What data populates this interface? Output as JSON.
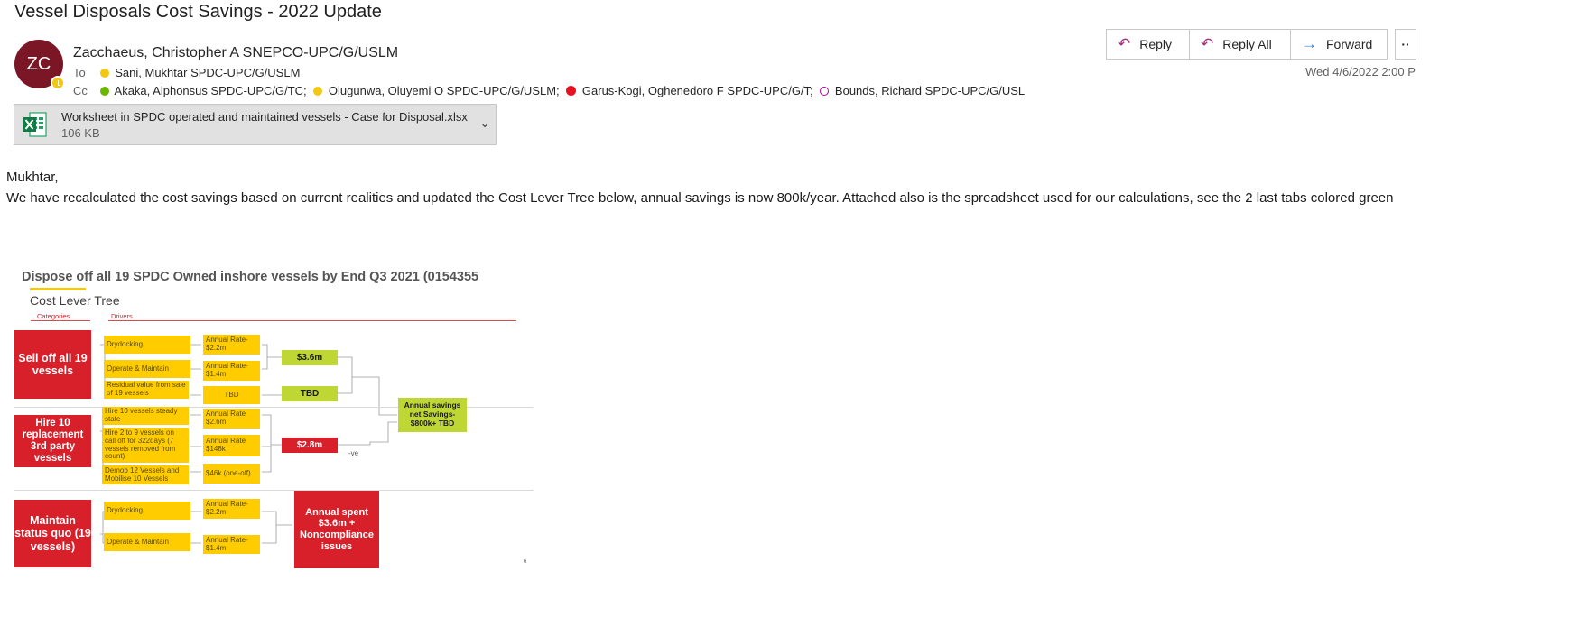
{
  "email": {
    "subject": "Vessel Disposals Cost Savings - 2022 Update",
    "avatar_initials": "ZC",
    "sender": "Zacchaeus, Christopher A SNEPCO-UPC/G/USLM",
    "to_label": "To",
    "to": "Sani, Mukhtar SPDC-UPC/G/USLM",
    "cc_label": "Cc",
    "cc": [
      {
        "name": "Akaka, Alphonsus SPDC-UPC/G/TC;",
        "status": "available"
      },
      {
        "name": "Olugunwa, Oluyemi O SPDC-UPC/G/USLM;",
        "status": "away"
      },
      {
        "name": "Garus-Kogi, Oghenedoro F SPDC-UPC/G/T;",
        "status": "busy"
      },
      {
        "name": "Bounds, Richard SPDC-UPC/G/USL",
        "status": "out-of-office"
      }
    ],
    "date": "Wed 4/6/2022 2:00 P",
    "actions": {
      "reply": "Reply",
      "reply_all": "Reply All",
      "forward": "Forward",
      "more": "··"
    },
    "attachment": {
      "name": "Worksheet in SPDC operated and maintained vessels - Case for Disposal.xlsx",
      "size": "106 KB",
      "icon": "excel-icon"
    },
    "greeting": "Mukhtar,",
    "body": "We have recalculated the cost savings based on current realities and updated the Cost Lever Tree below, annual savings is now 800k/year. Attached  also is the spreadsheet used for our calculations,  see the 2 last tabs colored green"
  },
  "diagram": {
    "title": "Dispose off all 19 SPDC Owned inshore vessels by End Q3 2021 (0154355",
    "subtitle": "Cost Lever Tree",
    "categories_label": "Categories",
    "drivers_label": "Drivers",
    "cat1": "Sell off all 19 vessels",
    "cat2": "Hire 10 replacement 3rd party vessels",
    "cat3": "Maintain status quo (19 vessels)",
    "d_drydocking": "Drydocking",
    "d_operate": "Operate & Maintain",
    "d_residual": "Residual value from sale of 19 vessels",
    "d_hire10": "Hire 10 vessels steady state",
    "d_hire2": "Hire 2 to 9 vessels on call off for 322days (7 vessels removed from count)",
    "d_demob": "Demob 12 Vessels and Mobilise 10 Vessels",
    "r_22": "Annual Rate- $2.2m",
    "r_14": "Annual Rate- $1.4m",
    "r_tbd": "TBD",
    "r_26": "Annual Rate $2.6m",
    "r_148": "Annual Rate $148k",
    "r_46": "$46k (one-off)",
    "s_36": "$3.6m",
    "s_tbd": "TBD",
    "s_28": "$2.8m",
    "ve": "-ve",
    "total": "Annual savings net Savings- $800k+ TBD",
    "status_quo": "Annual spent $3.6m + Noncompliance issues",
    "page_no": "6"
  }
}
